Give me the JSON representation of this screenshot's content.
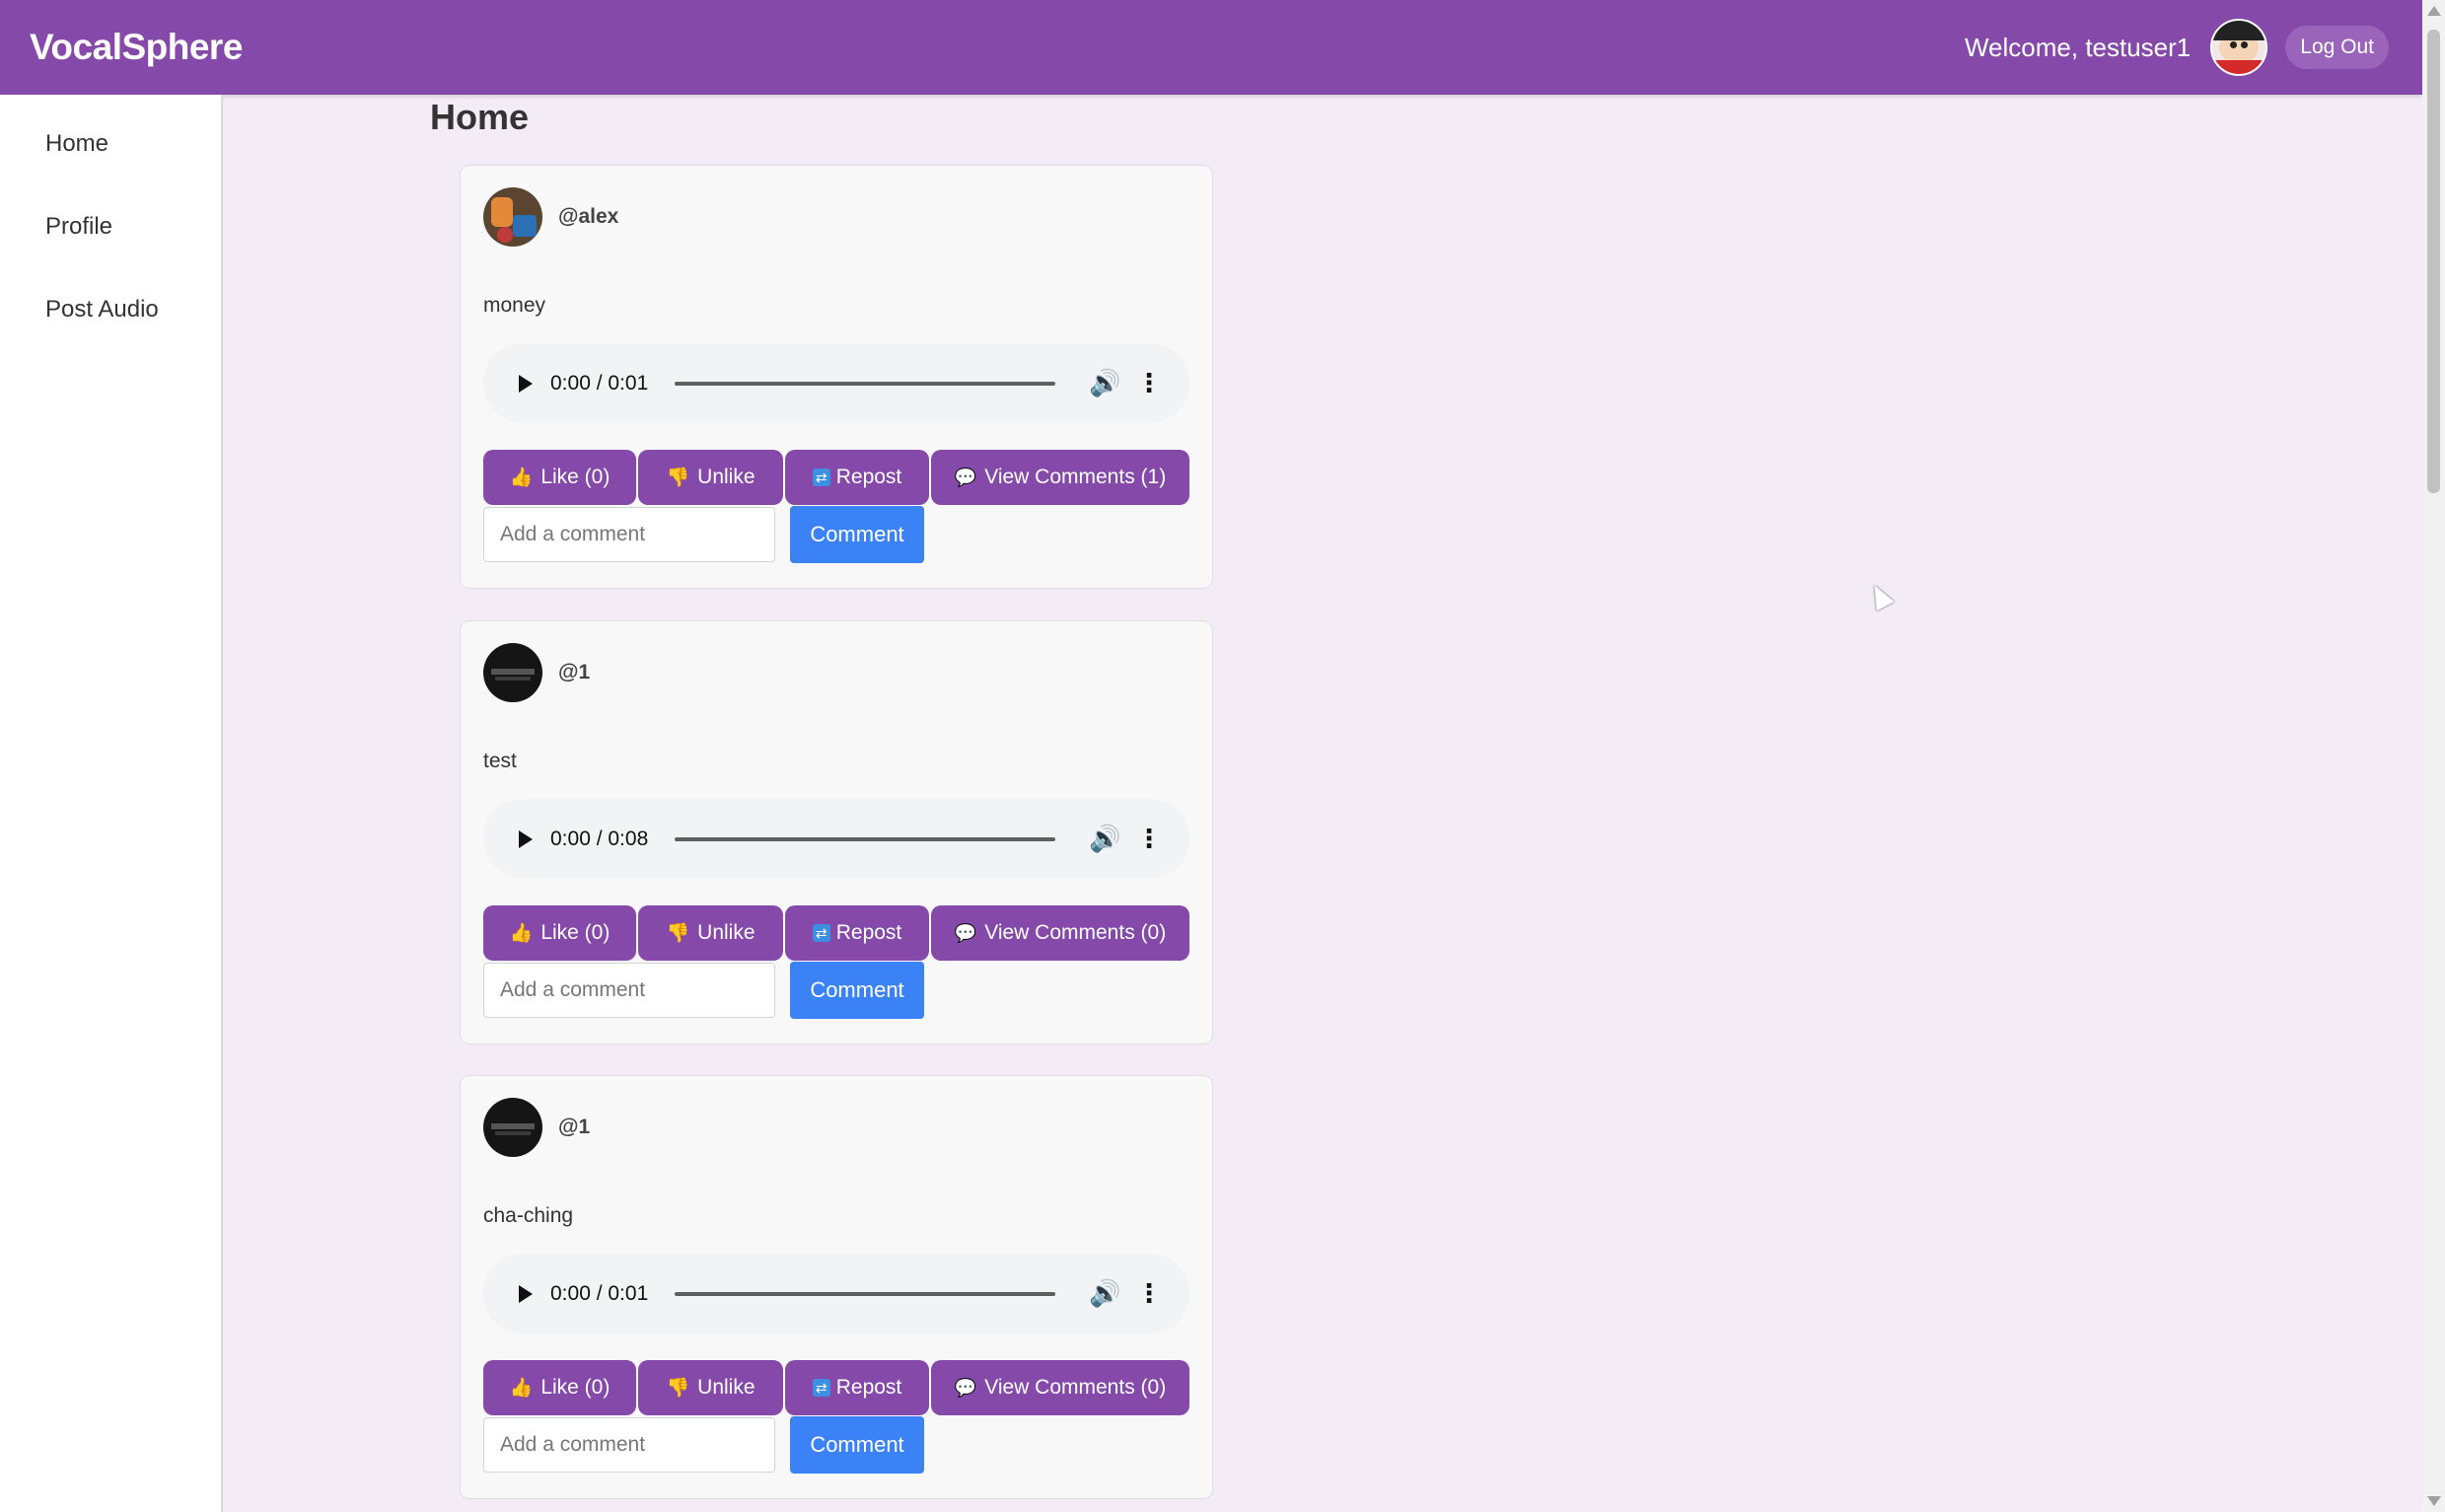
{
  "header": {
    "brand": "VocalSphere",
    "welcome": "Welcome, testuser1",
    "logout_label": "Log Out",
    "color": "#854aa9"
  },
  "sidebar": {
    "items": [
      {
        "label": "Home"
      },
      {
        "label": "Profile"
      },
      {
        "label": "Post Audio"
      }
    ]
  },
  "main": {
    "title": "Home",
    "posts": [
      {
        "username": "@alex",
        "text": "money",
        "time": "0:00 / 0:01",
        "like_label": "Like (0)",
        "unlike_label": "Unlike",
        "repost_label": "Repost",
        "comments_label": "View Comments (1)",
        "comment_placeholder": "Add a comment",
        "comment_button": "Comment"
      },
      {
        "username": "@1",
        "text": "test",
        "time": "0:00 / 0:08",
        "like_label": "Like (0)",
        "unlike_label": "Unlike",
        "repost_label": "Repost",
        "comments_label": "View Comments (0)",
        "comment_placeholder": "Add a comment",
        "comment_button": "Comment"
      },
      {
        "username": "@1",
        "text": "cha-ching",
        "time": "0:00 / 0:01",
        "like_label": "Like (0)",
        "unlike_label": "Unlike",
        "repost_label": "Repost",
        "comments_label": "View Comments (0)",
        "comment_placeholder": "Add a comment",
        "comment_button": "Comment"
      }
    ]
  },
  "icons": {
    "like": "thumbs-up-icon",
    "unlike": "thumbs-down-icon",
    "repost": "repost-icon",
    "comments": "speech-bubble-icon",
    "play": "play-icon",
    "volume": "volume-icon",
    "more": "more-vertical-icon"
  }
}
